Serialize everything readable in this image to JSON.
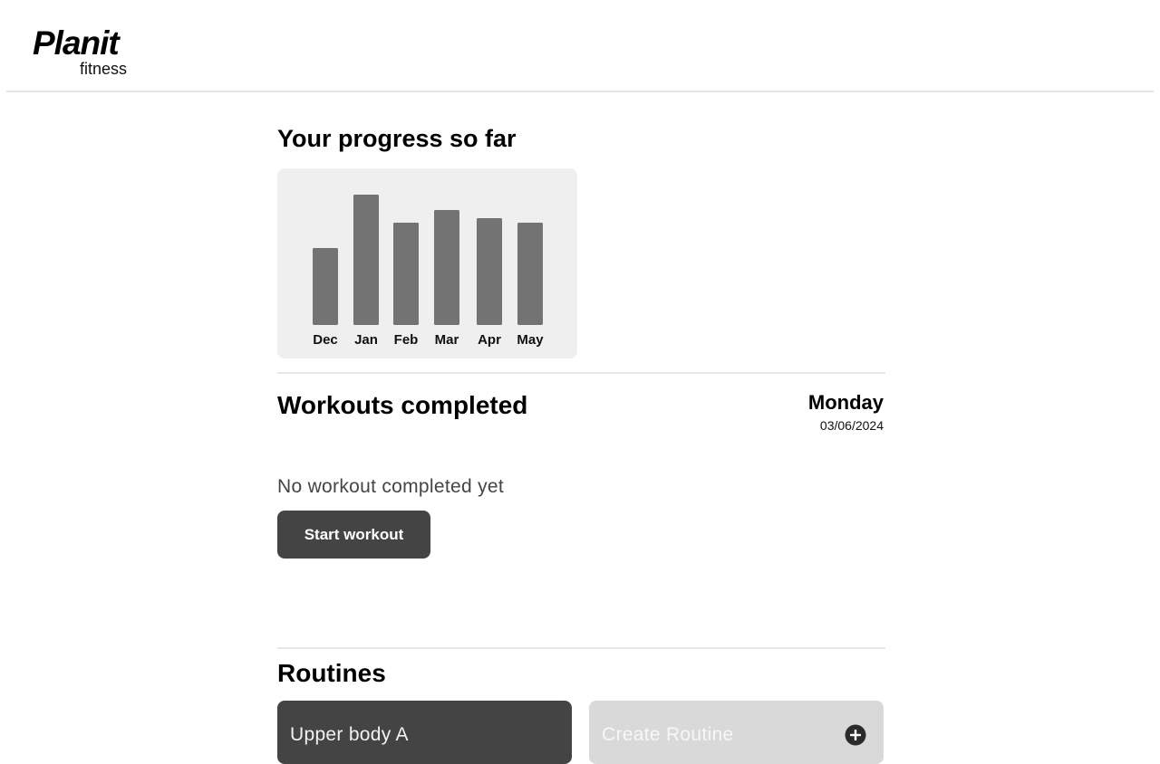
{
  "brand": {
    "name": "Planit",
    "subtitle": "fitness"
  },
  "progress": {
    "title": "Your progress so far"
  },
  "chart_data": {
    "type": "bar",
    "categories": [
      "Dec",
      "Jan",
      "Feb",
      "Mar",
      "Apr",
      "May"
    ],
    "values": [
      85,
      144,
      113,
      127,
      118,
      113
    ],
    "ylim": [
      0,
      150
    ],
    "grid": false,
    "bar_color": "#737373"
  },
  "workouts": {
    "title": "Workouts completed",
    "day": "Monday",
    "date": "03/06/2024",
    "empty_message": "No workout completed yet",
    "start_button": "Start workout"
  },
  "routines": {
    "title": "Routines",
    "items": [
      {
        "label": "Upper body A"
      }
    ],
    "create_label": "Create Routine",
    "create_icon": "plus-circle-icon"
  },
  "colors": {
    "button_dark": "#444444",
    "card_light": "#d9d9d9",
    "chart_bg": "#efefef"
  }
}
